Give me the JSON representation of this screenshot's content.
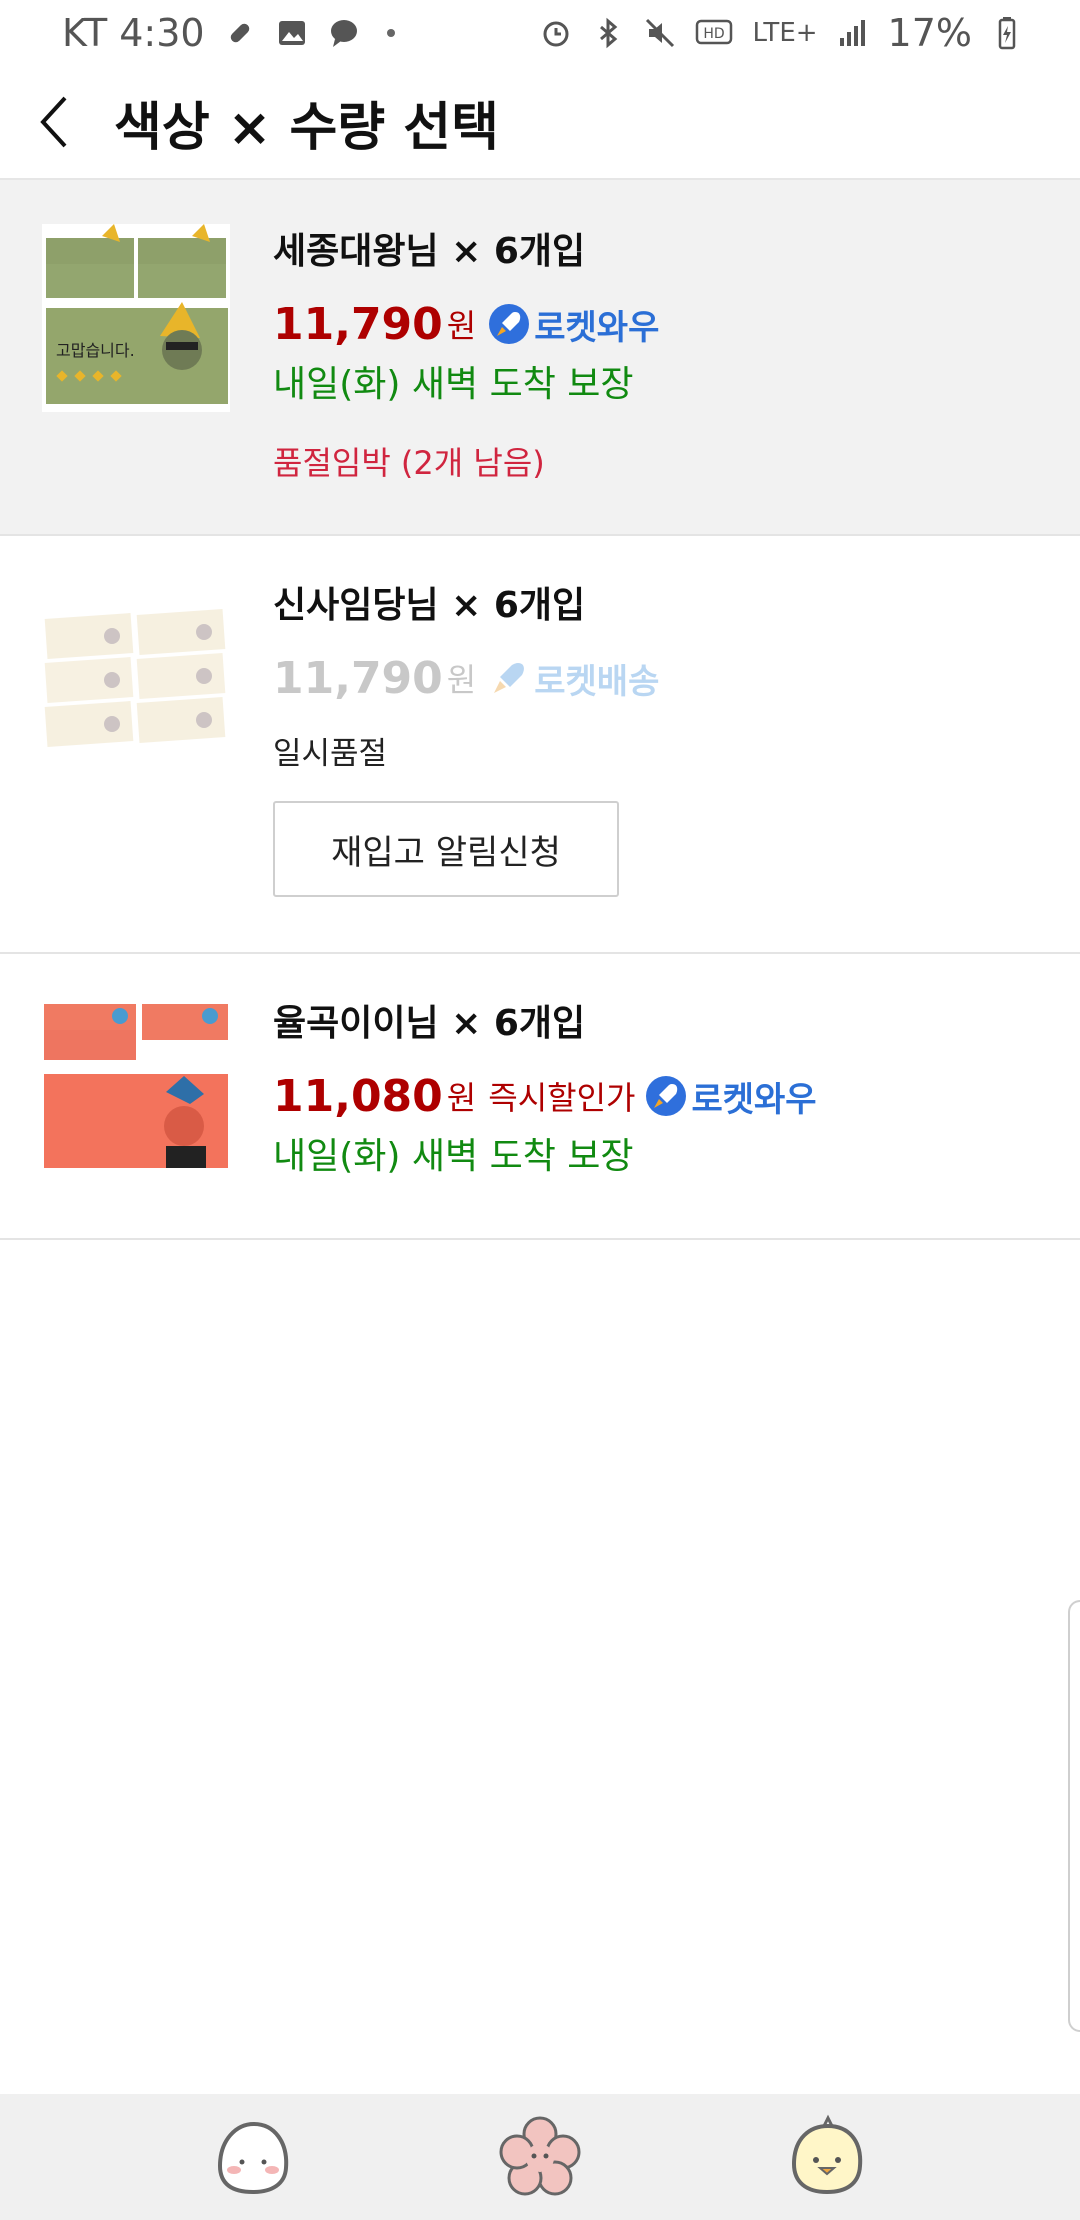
{
  "status_bar": {
    "carrier_time": "KT 4:30",
    "network": "LTE+",
    "battery": "17%"
  },
  "header": {
    "title": "색상 × 수량 선택"
  },
  "options": [
    {
      "name": "세종대왕님 × 6개입",
      "price": "11,790",
      "currency": "원",
      "badge": "로켓와우",
      "delivery": "내일(화) 새벽 도착 보장",
      "stock_note": "품절임박 (2개 남음)",
      "thumb_image_text": "고맙습니다."
    },
    {
      "name": "신사임당님 × 6개입",
      "price": "11,790",
      "currency": "원",
      "badge": "로켓배송",
      "soldout": "일시품절",
      "notify_button": "재입고 알림신청"
    },
    {
      "name": "율곡이이님 × 6개입",
      "price": "11,080",
      "currency": "원",
      "instant_discount": "즉시할인가",
      "badge": "로켓와우",
      "delivery": "내일(화) 새벽 도착 보장"
    }
  ],
  "colors": {
    "price_red": "#ae0000",
    "delivery_green": "#118a11",
    "warning_red": "#d0253f",
    "rocket_blue": "#2b6fd6",
    "selected_bg": "#f2f2f2"
  }
}
